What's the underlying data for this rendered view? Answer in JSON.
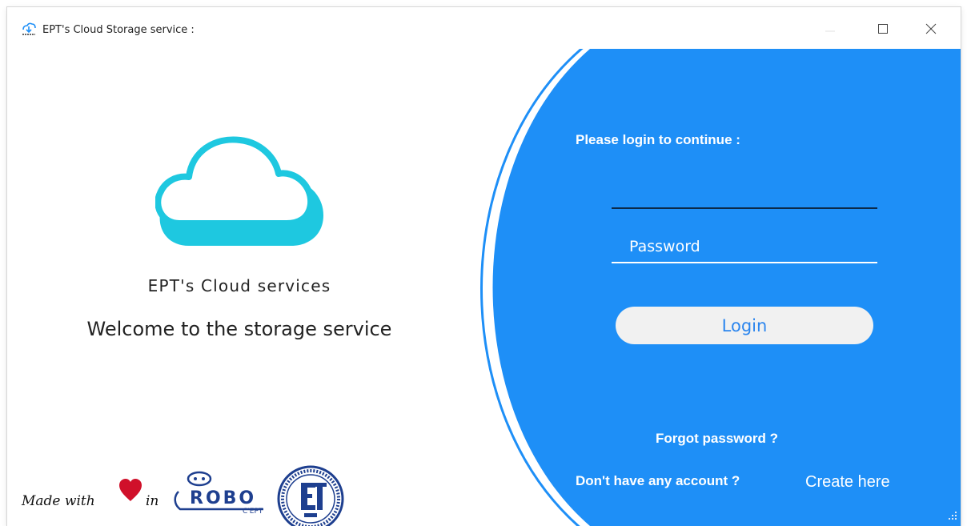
{
  "window": {
    "title": "EPT's Cloud Storage service :"
  },
  "branding": {
    "title": "EPT's Cloud services",
    "welcome": "Welcome to the storage service"
  },
  "footer": {
    "made_with": "Made with",
    "in": "in",
    "robo_name": "ROBO",
    "robo_sub": "C'EPT"
  },
  "login": {
    "heading": "Please login to continue :",
    "username_value": "",
    "password_placeholder": "Password",
    "login_label": "Login",
    "forgot_label": "Forgot password ?",
    "no_account_text": "Don't have any account ?",
    "create_label": "Create here"
  },
  "colors": {
    "panel_blue": "#1e8ff7",
    "cloud_cyan": "#1ec8e0",
    "heart_red": "#d0102a"
  },
  "icons": [
    "cloud-download-icon",
    "minimize-icon",
    "maximize-icon",
    "close-icon",
    "cloud-icon",
    "heart-icon",
    "resize-grip-icon"
  ]
}
